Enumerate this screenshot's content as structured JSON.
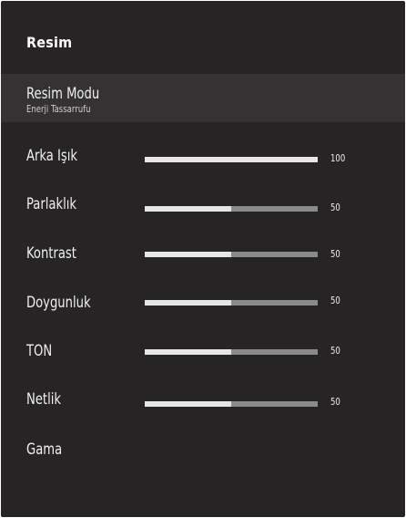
{
  "header": {
    "title": "Resim"
  },
  "picture_mode": {
    "label": "Resim Modu",
    "value": "Enerji Tassarrufu"
  },
  "sliders": [
    {
      "label": "Arka Işık",
      "value": "100",
      "level": 100
    },
    {
      "label": "Parlaklık",
      "value": "50",
      "level": 50
    },
    {
      "label": "Kontrast",
      "value": "50",
      "level": 50
    },
    {
      "label": "Doygunluk",
      "value": "50",
      "level": 50
    },
    {
      "label": "TON",
      "value": "50",
      "level": 50
    },
    {
      "label": "Netlik",
      "value": "50",
      "level": 50
    }
  ],
  "gamma": {
    "label": "Gama"
  },
  "colors": {
    "panel_bg": "#262424",
    "selected_row_bg": "#343232",
    "slider_fill": "#e6e6e6",
    "slider_track": "#8a8a8a",
    "text": "#f0f0f0"
  }
}
